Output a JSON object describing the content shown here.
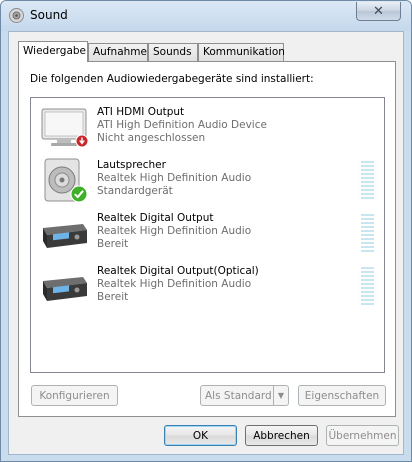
{
  "window": {
    "title": "Sound",
    "close_label": "✕"
  },
  "tabs": [
    {
      "label": "Wiedergabe",
      "active": true
    },
    {
      "label": "Aufnahme",
      "active": false
    },
    {
      "label": "Sounds",
      "active": false
    },
    {
      "label": "Kommunikation",
      "active": false
    }
  ],
  "panel": {
    "intro": "Die folgenden Audiowiedergabegeräte sind installiert:"
  },
  "devices": [
    {
      "name": "ATI HDMI Output",
      "driver": "ATI High Definition Audio Device",
      "status": "Nicht angeschlossen",
      "icon": "monitor-icon",
      "badge": "disconnected-badge-icon"
    },
    {
      "name": "Lautsprecher",
      "driver": "Realtek High Definition Audio",
      "status": "Standardgerät",
      "icon": "speaker-icon",
      "badge": "default-device-check-icon"
    },
    {
      "name": "Realtek Digital Output",
      "driver": "Realtek High Definition Audio",
      "status": "Bereit",
      "icon": "digital-output-icon"
    },
    {
      "name": "Realtek Digital Output(Optical)",
      "driver": "Realtek High Definition Audio",
      "status": "Bereit",
      "icon": "digital-output-icon"
    }
  ],
  "buttons": {
    "configure": "Konfigurieren",
    "set_default": "Als Standard",
    "properties": "Eigenschaften",
    "ok": "OK",
    "cancel": "Abbrechen",
    "apply": "Übernehmen"
  },
  "colors": {
    "window_frame": "#c9dcee",
    "dialog_background": "#f0f0f0",
    "disabled_text": "#8d8d8d",
    "secondary_text": "#6d6d6d",
    "default_check": "#3fb02a",
    "disconnected_badge": "#c8282b",
    "level_meter": "#c9e5f0"
  }
}
